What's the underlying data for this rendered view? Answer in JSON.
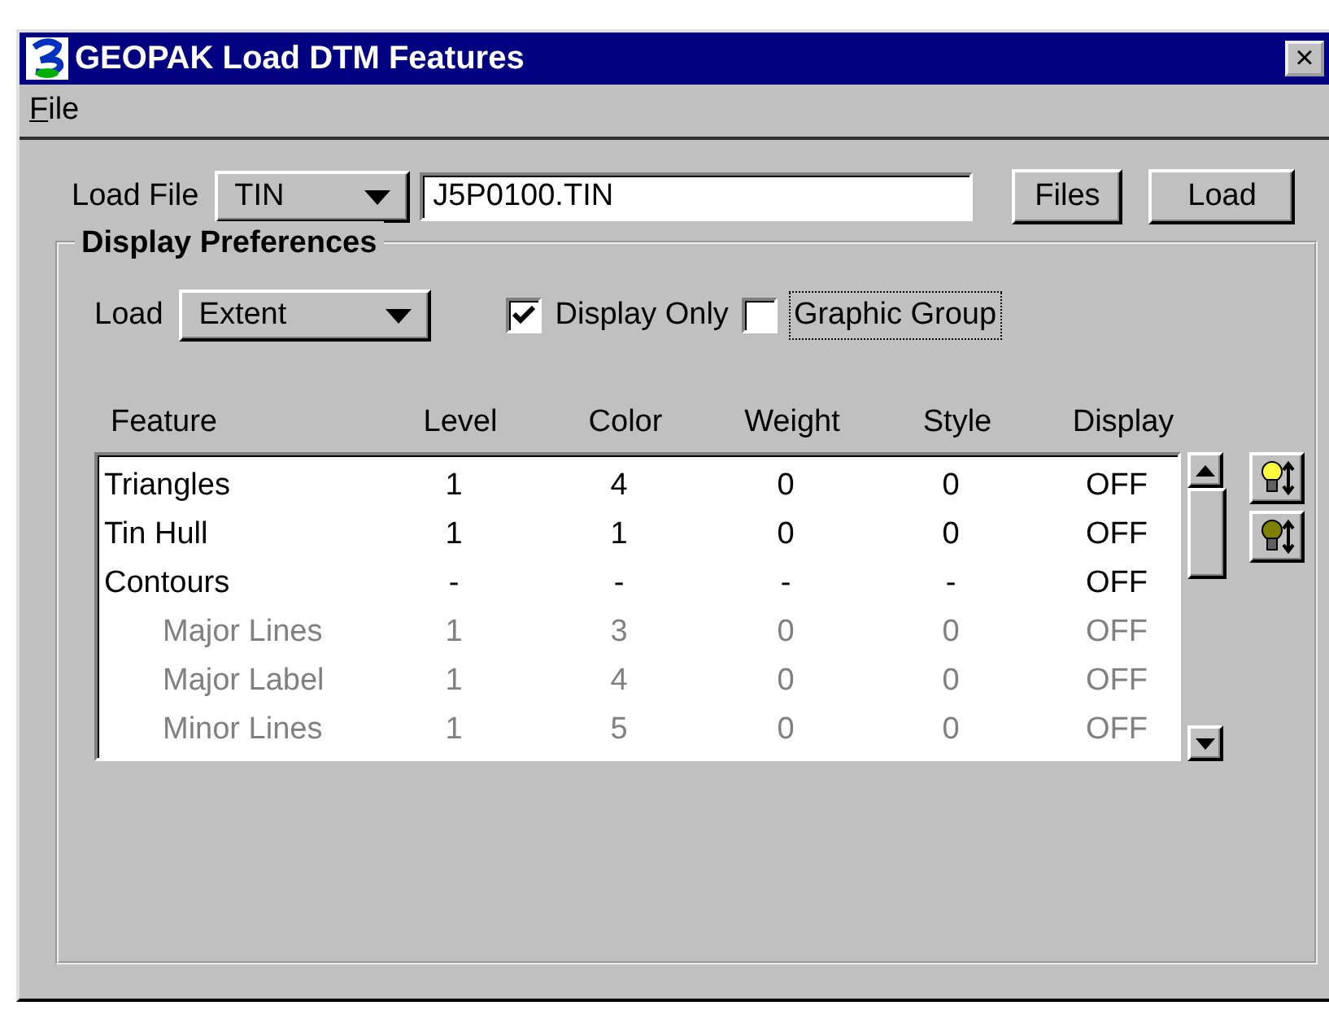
{
  "window": {
    "title": "GEOPAK Load DTM Features",
    "close": "×"
  },
  "menu": [
    "File"
  ],
  "load_file": {
    "label": "Load File",
    "type": "TIN",
    "file": "J5P0100.TIN",
    "buttons": [
      "Files",
      "Load"
    ]
  },
  "display_preferences": {
    "title": "Display Preferences",
    "load_label": "Load",
    "load_value": "Extent",
    "options": [
      {
        "label": "Display Only",
        "checked": true,
        "focused": false
      },
      {
        "label": "Graphic Group",
        "checked": false,
        "focused": true
      }
    ]
  },
  "table": {
    "columns": [
      "Feature",
      "Level",
      "Color",
      "Weight",
      "Style",
      "Display"
    ],
    "rows": [
      {
        "cells": [
          "Triangles",
          "1",
          "4",
          "0",
          "0",
          "OFF"
        ],
        "disabled": false
      },
      {
        "cells": [
          "Tin Hull",
          "1",
          "1",
          "0",
          "0",
          "OFF"
        ],
        "disabled": false
      },
      {
        "cells": [
          "Contours",
          "-",
          "-",
          "-",
          "-",
          "OFF"
        ],
        "disabled": false,
        "children": [
          {
            "cells": [
              "Major Lines",
              "1",
              "3",
              "0",
              "0",
              "OFF"
            ],
            "disabled": true
          },
          {
            "cells": [
              "Major Label",
              "1",
              "4",
              "0",
              "0",
              "OFF"
            ],
            "disabled": true
          },
          {
            "cells": [
              "Minor Lines",
              "1",
              "5",
              "0",
              "0",
              "OFF"
            ],
            "disabled": true
          }
        ]
      }
    ]
  }
}
